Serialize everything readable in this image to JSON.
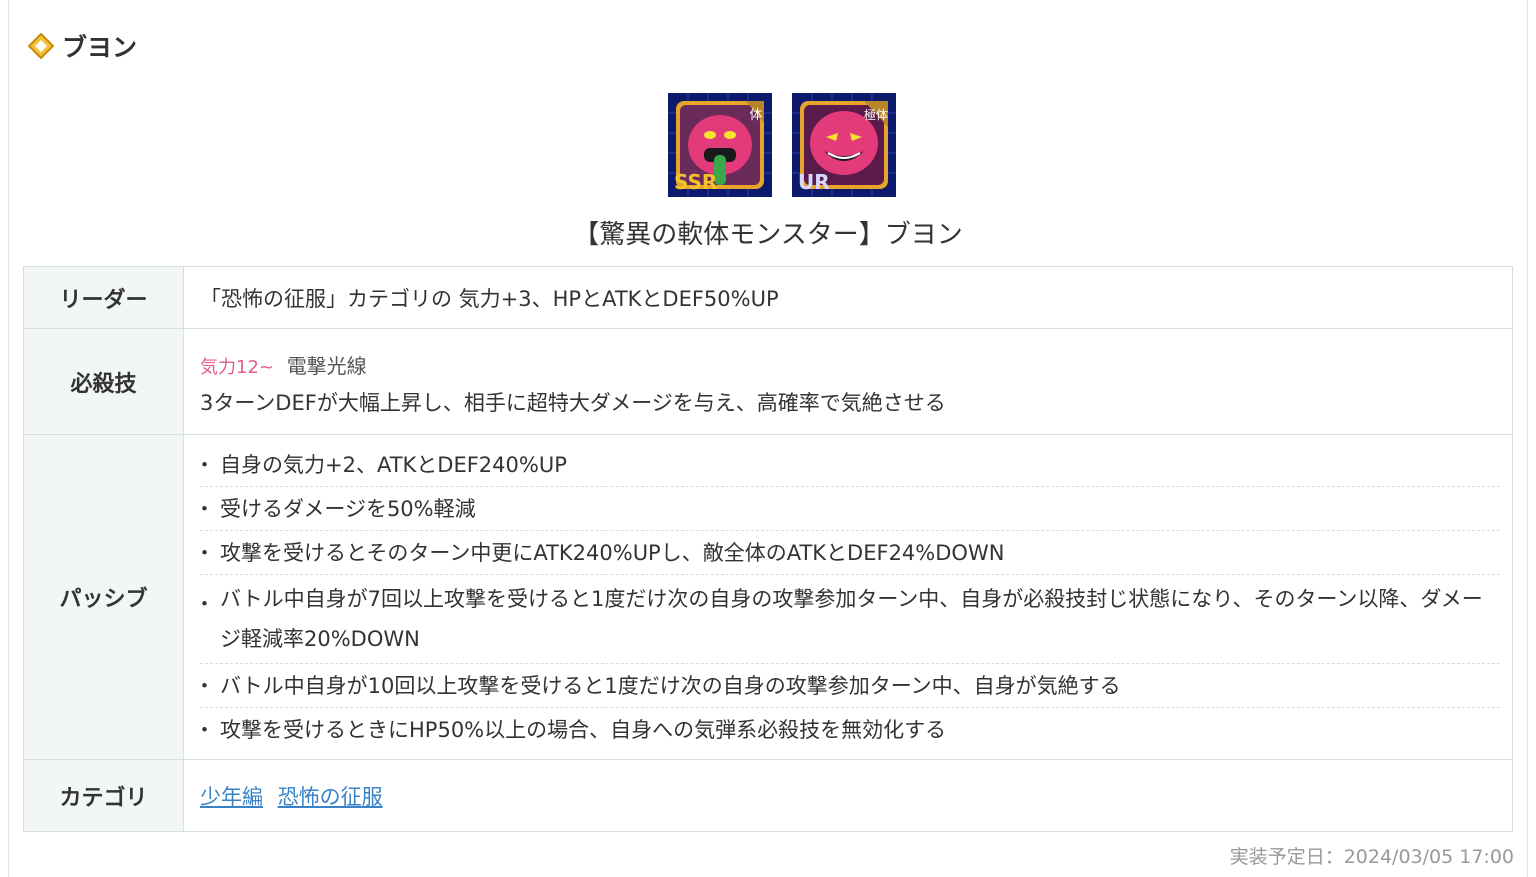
{
  "header": {
    "title": "ブヨン",
    "icon": "diamond-icon"
  },
  "cards": [
    {
      "rarity": "SSR",
      "type_badge": "体",
      "icon": "card-icon-ssr"
    },
    {
      "rarity": "UR",
      "type_badge": "極体",
      "icon": "card-icon-ur"
    }
  ],
  "card_title": "【驚異の軟体モンスター】ブヨン",
  "table": {
    "leader": {
      "label": "リーダー",
      "text": "「恐怖の征服」カテゴリの 気力+3、HPとATKとDEF50%UP"
    },
    "super": {
      "label": "必殺技",
      "ki": "気力12~",
      "name": "電撃光線",
      "effect": "3ターンDEFが大幅上昇し、相手に超特大ダメージを与え、高確率で気絶させる"
    },
    "passive": {
      "label": "パッシブ",
      "items": [
        "自身の気力+2、ATKとDEF240%UP",
        "受けるダメージを50%軽減",
        "攻撃を受けるとそのターン中更にATK240%UPし、敵全体のATKとDEF24%DOWN",
        "バトル中自身が7回以上攻撃を受けると1度だけ次の自身の攻撃参加ターン中、自身が必殺技封じ状態になり、そのターン以降、ダメージ軽減率20%DOWN",
        "バトル中自身が10回以上攻撃を受けると1度だけ次の自身の攻撃参加ターン中、自身が気絶する",
        "攻撃を受けるときにHP50%以上の場合、自身への気弾系必殺技を無効化する"
      ]
    },
    "category": {
      "label": "カテゴリ",
      "links": [
        "少年編",
        "恐怖の征服"
      ]
    }
  },
  "release": "実装予定日：2024/03/05 17:00",
  "colors": {
    "ki": "#e0608a",
    "link": "#3a82c8",
    "header_cell": "#f2f6f7",
    "border": "#d8dfe2"
  }
}
